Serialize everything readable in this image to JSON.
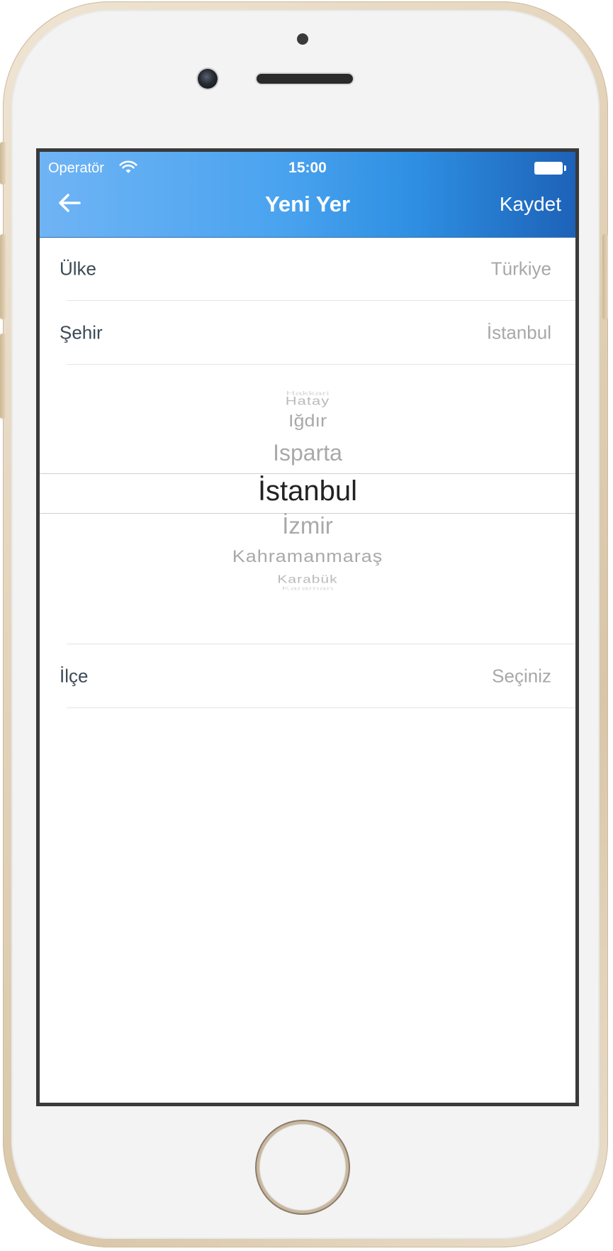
{
  "status_bar": {
    "carrier": "Operatör",
    "time": "15:00"
  },
  "nav_bar": {
    "title": "Yeni Yer",
    "save_label": "Kaydet"
  },
  "form": {
    "rows": [
      {
        "label": "Ülke",
        "value": "Türkiye"
      },
      {
        "label": "Şehir",
        "value": "İstanbul"
      },
      {
        "label": "İlçe",
        "value": "Seçiniz"
      }
    ]
  },
  "city_picker": {
    "items": [
      "Hakkari",
      "Hatay",
      "Iğdır",
      "Isparta",
      "İstanbul",
      "İzmir",
      "Kahramanmaraş",
      "Karabük",
      "Karaman"
    ],
    "selected": "İstanbul"
  },
  "colors": {
    "nav_gradient_start": "#6fb4f5",
    "nav_gradient_end": "#1d62b8",
    "label_text": "#3d4a57",
    "value_text": "#a8a8a8"
  }
}
